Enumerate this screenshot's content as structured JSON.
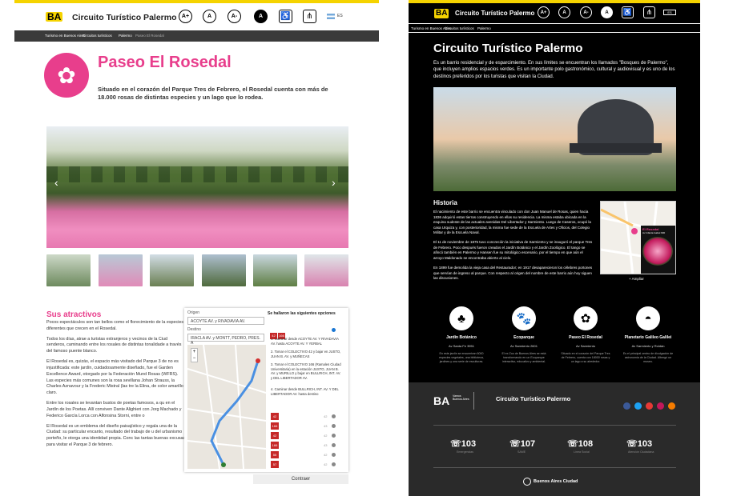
{
  "left": {
    "logo": "BA",
    "site_title": "Circuito Turístico Palermo",
    "buttons": {
      "font_up": "A+",
      "font_normal": "A",
      "font_down": "A-",
      "contrast": "A",
      "lang": "ES"
    },
    "breadcrumb": [
      "Turismo en Buenos Aires",
      "Circuitos turísticos",
      "Palermo",
      "Paseo El Rosedal"
    ],
    "page_title": "Paseo El Rosedal",
    "intro": "Situado en el corazón del Parque Tres de Febrero, el Rosedal cuenta con más de 18.000 rosas de distintas especies y un lago que lo rodea.",
    "section_title": "Sus atractivos",
    "paragraphs": [
      "Pocos espectáculos son tan bellos como el florecimiento de la especies diferentes que crecen en el Rosedal.",
      "Todos los días, atrae a turistas extranjeros y vecinos de la Ciud senderos, caminando entre los rosales de distintas tonalidade a través del famoso puente blanco.",
      "El Rosedal es, quizás, el espacio más visitado del Parque 3 de no es injustificada: este jardín, cuidadosamente diseñado, fue el Garden Excellence Award, otorgado por la Federación Mund Rosas (WFRS). Las especies más comunes son la rosa sevillana Johan Strauss, la Charles Aznavour y la Frederic Mistral (las tre la Elina, de color amarillo claro.",
      "Entre los rosales se levantan bustos de poetas famosos, a qu en el Jardín de los Poetas. Allí conviven Dante Alighieri con Jorg Machado y Federico García Lorca con Alfonsina Storni, entre o",
      "El Rosedal es un emblema del diseño paisajístico y regala una de la Ciudad: su particular encanto, resultado del trabajo de u del urbanismo porteño, le otorga una identidad propia. Conc las tantas buenas excusas para visitar el Parque 3 de febrero."
    ],
    "route": {
      "origin_label": "Origen",
      "origin_value": "ACOYTE AV. y RIVADAVIA AV.",
      "dest_label": "Destino",
      "dest_value": "IRACLA AV. y MONTT, PEDRO, PRES. A",
      "results_title": "Se hallaron las siguientes opciones",
      "badges": [
        "42",
        "166"
      ],
      "steps": [
        "1. Caminar desde ACOYTE AV. Y RIVADAVIA AV. hasta ACOYTE AV. Y YERBAL",
        "2. Tomar el COLECTIVO 42 y bajar en JUSTO, JUAN B. AV. y MUÑECAS",
        "3. Tomar el COLECTIVO 166 (Ramales Ciudad Universitaria) en la estación JUSTO, JUAN B. AV. y MURILLO y bajar en BULLRICH, INT. AV. y DEL LIBERTADOR AV.",
        "4. Caminar desde BULLRICH, INT. AV. Y DEL LIBERTADOR AV. hasta destino"
      ],
      "rows": [
        {
          "badge": "42",
          "num": "42"
        },
        {
          "badge": "166",
          "num": "43"
        },
        {
          "badge": "42",
          "num": "42"
        },
        {
          "badge": "166",
          "num": "43"
        },
        {
          "badge": "55",
          "num": "42"
        },
        {
          "badge": "57",
          "num": "42"
        },
        {
          "badge": "55",
          "num": "42"
        }
      ],
      "collapse": "Contraer"
    }
  },
  "right": {
    "logo": "BA",
    "site_title": "Circuito Turístico Palermo",
    "breadcrumb": [
      "Turismo en Buenos Aires",
      "Circuitos turísticos",
      "Palermo"
    ],
    "page_title": "Circuito Turístico Palermo",
    "intro": "Es un barrio residencial y de esparcimiento. En sus límites se encuentran los llamados \"Bosques de Palermo\", que incluyen amplios espacios verdes. Es un importante polo gastronómico, cultural y audiovisual y es uno de los destinos preferidos por los turistas que visitan la Ciudad.",
    "history_title": "Historia",
    "history": [
      "El nacimiento de este barrio se encuentra vinculado con don Juan Manuel de Rosas, quien hacia 1836 adquirió estas tierras construyendo en ellas su residencia. La misma estaba ubicada en la esquina sudeste de las actuales avenidas Del Libertador y Sarmiento. Luego de Caseros, ocupó la casa Urquiza y, con posterioridad, la misma fue sede de la Escuela de Artes y Oficios, del Colegio Militar y de la Escuela Naval.",
      "El 11 de noviembre de 1875 tuvo concreción la iniciativa de Sarmiento y se inauguró el parque Tres de Febrero. Poco después fueron creados el Jardín Botánico y el Jardín Zoológico. El tango se afincó también en Palermo y Hansen fue su mitológico escenario, por el tiempo en que aún el arroyo Maldonado se encontraba abierto al cielo.",
      "En 1899 fue demolida la vieja casa del Restaurador; en 1917 desaparecieron los célebres portones que servían de ingreso al parque. Con respecto al origen del nombre de este barrio aún hoy siguen las discusiones."
    ],
    "map_card": {
      "name": "El Rosedal",
      "address": "Av Infanta Isabel 900",
      "expand": "+ Ampliar"
    },
    "places": [
      {
        "name": "Jardín Botánico",
        "address": "Av Santa Fe 3951",
        "desc": "En este jardín se encuentran 6000 especies vegetales, una biblioteca, jardines y una serie de esculturas.",
        "icon": "tree-icon"
      },
      {
        "name": "Ecoparque",
        "address": "Av Sarmiento 2601",
        "desc": "El ex Zoo de Buenos Aires se está transformando en un Ecoparque interactivo, educativo y ambiental.",
        "icon": "paw-icon"
      },
      {
        "name": "Paseo El Rosedal",
        "address": "Av Sarmiento",
        "desc": "Situado en el corazón del Parque Tres de Febrero, cuenta con 18000 rosas y un lago a su alrededor.",
        "icon": "rose-icon"
      },
      {
        "name": "Planetario Galileo Galilei",
        "address": "Av Sarmiento y Roldán",
        "desc": "Es el principal centro de divulgación de astronomía de la Ciudad. Albergó un museo.",
        "icon": "planetarium-icon"
      }
    ],
    "footer": {
      "logo_text": "Vamos Buenos Aires",
      "title": "Circuito Turístico Palermo",
      "phones": [
        {
          "num": "103",
          "label": "Emergencias"
        },
        {
          "num": "107",
          "label": "SAME"
        },
        {
          "num": "108",
          "label": "Línea Social"
        },
        {
          "num": "103",
          "label": "Atención Ciudadana"
        }
      ],
      "city": "Buenos Aires Ciudad"
    }
  },
  "colors": {
    "yellow": "#f5d300",
    "pink": "#e83e8c",
    "red_badge": "#c62828"
  }
}
